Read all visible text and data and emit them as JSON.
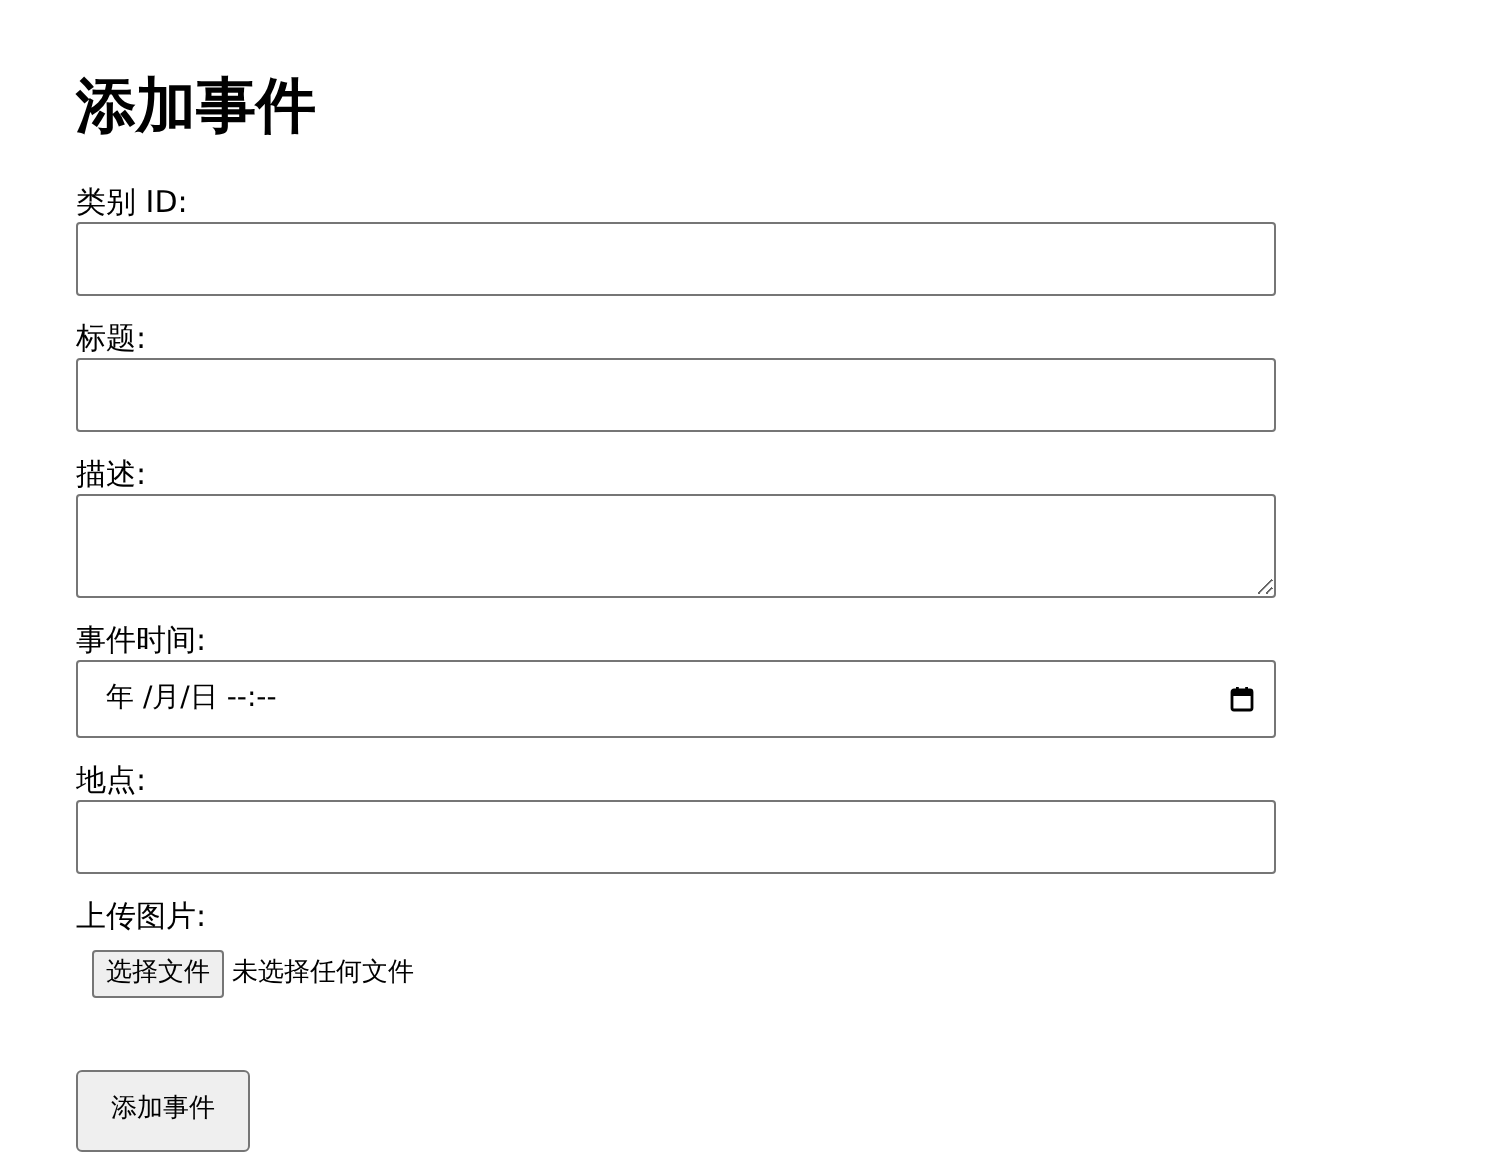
{
  "title": "添加事件",
  "fields": [
    {
      "label": "类别 ID:",
      "kind": "text"
    },
    {
      "label": "标题:",
      "kind": "text"
    },
    {
      "label": "描述:",
      "kind": "textarea"
    },
    {
      "label": "事件时间:",
      "kind": "datetime",
      "value": "年 /月/日  --:--"
    },
    {
      "label": "地点:",
      "kind": "text"
    },
    {
      "label": "上传图片:",
      "kind": "file",
      "button": "选择文件",
      "status": "未选择任何文件"
    }
  ],
  "submit": "添加事件"
}
